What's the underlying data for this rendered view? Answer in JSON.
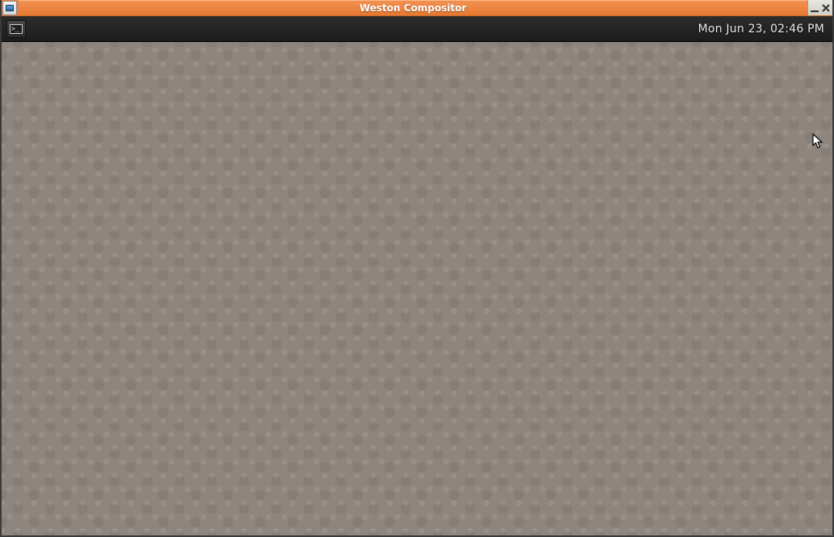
{
  "window": {
    "title": "Weston Compositor"
  },
  "panel": {
    "clock": "Mon Jun 23, 02:46 PM"
  }
}
